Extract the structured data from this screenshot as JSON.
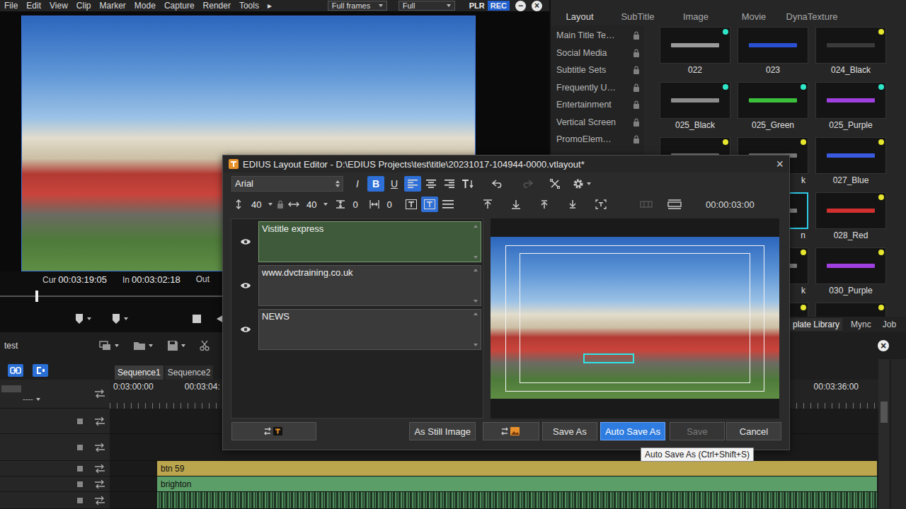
{
  "menu": [
    "File",
    "Edit",
    "View",
    "Clip",
    "Marker",
    "Mode",
    "Capture",
    "Render",
    "Tools",
    "▸"
  ],
  "player": {
    "dropdowns": [
      "Full frames",
      "Full"
    ],
    "modes": [
      {
        "label": "PLR",
        "selected": false
      },
      {
        "label": "REC",
        "selected": true
      }
    ],
    "window_buttons": [
      "−",
      "×"
    ],
    "timecodes": [
      {
        "label": "Cur",
        "value": "00:03:19:05"
      },
      {
        "label": "In",
        "value": "00:03:02:18"
      },
      {
        "label": "Out"
      }
    ],
    "scrub": {
      "level": 0.075
    }
  },
  "library": {
    "tabs": [
      {
        "label": "Layout",
        "selected": true
      },
      {
        "label": "SubTitle",
        "selected": false
      },
      {
        "label": "Image",
        "selected": false
      },
      {
        "label": "Movie",
        "selected": false
      },
      {
        "label": "DynaTexture",
        "selected": false
      }
    ],
    "categories": [
      {
        "label": "Main Title Te…",
        "locked": true
      },
      {
        "label": "Social Media",
        "locked": true
      },
      {
        "label": "Subtitle Sets",
        "locked": true
      },
      {
        "label": "Frequently U…",
        "locked": true
      },
      {
        "label": "Entertainment",
        "locked": true
      },
      {
        "label": "Vertical Screen",
        "locked": true
      },
      {
        "label": "PromoElem…",
        "locked": true
      }
    ],
    "thumbnails": [
      {
        "label": "022",
        "color": "#9a9a9a",
        "dot": "#2ee6c8",
        "selected": false,
        "kind": "full"
      },
      {
        "label": "023",
        "color": "#2a4fd0",
        "selected": false,
        "kind": "full"
      },
      {
        "label": "024_Black",
        "color": "#3a3a3a",
        "dot": "#e6e62e",
        "selected": false,
        "kind": "full"
      },
      {
        "label": "025_Black",
        "color": "#8c8c8c",
        "dot": "#2ee6c8",
        "selected": false,
        "kind": "full"
      },
      {
        "label": "025_Green",
        "color": "#3cc03c",
        "dot": "#2ee6c8",
        "selected": false,
        "kind": "full"
      },
      {
        "label": "025_Purple",
        "color": "#a040e0",
        "dot": "#2ee6c8",
        "selected": false,
        "kind": "full"
      },
      {
        "color": "#7a7a7a",
        "dot": "#e6e62e",
        "selected": false,
        "kind": "full"
      },
      {
        "label": "k",
        "color": "#7a7a7a",
        "dot": "#e6e62e",
        "selected": false,
        "kind": "cut"
      },
      {
        "label": "027_Blue",
        "color": "#3a5ae0",
        "dot": "#e6e62e",
        "selected": false,
        "kind": "full"
      },
      {
        "color": "#7a7a7a",
        "selected": false,
        "kind": "full"
      },
      {
        "label": "n",
        "color": "#7a7a7a",
        "selected": true,
        "kind": "cut"
      },
      {
        "label": "028_Red",
        "color": "#d03030",
        "dot": "#e6e62e",
        "selected": false,
        "kind": "full"
      },
      {
        "color": "#7a7a7a",
        "selected": false,
        "kind": "full"
      },
      {
        "label": "k",
        "color": "#7a7a7a",
        "dot": "#e6e62e",
        "selected": false,
        "kind": "cut"
      },
      {
        "label": "030_Purple",
        "color": "#a040e0",
        "dot": "#e6e62e",
        "selected": false,
        "kind": "full"
      },
      {
        "color": "#7a7a7a",
        "selected": false,
        "kind": "full"
      },
      {
        "color": "#7a7a7a",
        "dot": "#e6e62e",
        "selected": false,
        "kind": "full"
      },
      {
        "color": "#7a7a7a",
        "dot": "#e6e62e",
        "selected": false,
        "kind": "full"
      }
    ],
    "bottom_tabs": [
      {
        "label": "plate Library",
        "selected": true
      },
      {
        "label": "Mync",
        "selected": false
      },
      {
        "label": "Job",
        "selected": false
      }
    ]
  },
  "timeline": {
    "project": "test",
    "close": "×",
    "track_select": "----",
    "sequences": [
      {
        "label": "Sequence1",
        "selected": true
      },
      {
        "label": "Sequence2",
        "selected": false
      }
    ],
    "ruler": [
      "0:03:00:00",
      "00:03:04:",
      "00:03:36:00"
    ],
    "tracks": [
      {
        "kind": "empty"
      },
      {
        "kind": "empty"
      },
      {
        "kind": "clip",
        "label": "btn 59",
        "color": "#bba64e"
      },
      {
        "kind": "clip",
        "label": "brighton",
        "color": "#5c9e68"
      },
      {
        "kind": "wave",
        "color": "#4f8f5c"
      }
    ]
  },
  "dialog": {
    "title": "EDIUS Layout Editor - D:\\EDIUS Projects\\test\\title\\20231017-104944-0000.vtlayout*",
    "close": "×",
    "font": "Arial",
    "styles": [
      {
        "label": "I",
        "selected": false
      },
      {
        "label": "B",
        "selected": true
      },
      {
        "label": "U",
        "selected": false
      }
    ],
    "align": [
      {
        "kind": "left",
        "selected": true
      },
      {
        "kind": "center",
        "selected": false
      },
      {
        "kind": "right",
        "selected": false
      }
    ],
    "history": [
      {
        "kind": "undo",
        "disabled": false
      },
      {
        "kind": "redo",
        "disabled": true
      }
    ],
    "size_fields": [
      {
        "kind": "height",
        "value": "40"
      },
      {
        "kind": "width",
        "value": "40"
      }
    ],
    "spacing_fields": [
      {
        "kind": "leading",
        "value": "0"
      },
      {
        "kind": "kerning",
        "value": "0"
      }
    ],
    "direction": [
      {
        "kind": "horizontal",
        "selected": false
      },
      {
        "kind": "vertical",
        "selected": true
      }
    ],
    "distribute": [
      {
        "kind": "space",
        "disabled": true
      },
      {
        "kind": "fit",
        "disabled": false
      }
    ],
    "duration": "00:00:03:00",
    "layers": [
      {
        "text": "Vistitle express",
        "visible": true,
        "selected": true
      },
      {
        "text": "www.dvctraining.co.uk",
        "visible": true,
        "selected": false
      },
      {
        "text": "NEWS",
        "visible": true,
        "selected": false
      }
    ],
    "buttons": [
      {
        "kind": "to-title",
        "selected": false,
        "disabled": false
      },
      {
        "kind": "text",
        "label": "As Still Image",
        "selected": false,
        "disabled": false
      },
      {
        "kind": "to-image",
        "selected": false,
        "disabled": false
      },
      {
        "kind": "text",
        "label": "Save As",
        "selected": false,
        "disabled": false
      },
      {
        "kind": "text",
        "label": "Auto Save As",
        "selected": true,
        "disabled": false
      },
      {
        "kind": "text",
        "label": "Save",
        "selected": false,
        "disabled": true
      },
      {
        "kind": "text",
        "label": "Cancel",
        "selected": false,
        "disabled": false
      }
    ],
    "tooltip": "Auto Save As (Ctrl+Shift+S)"
  }
}
